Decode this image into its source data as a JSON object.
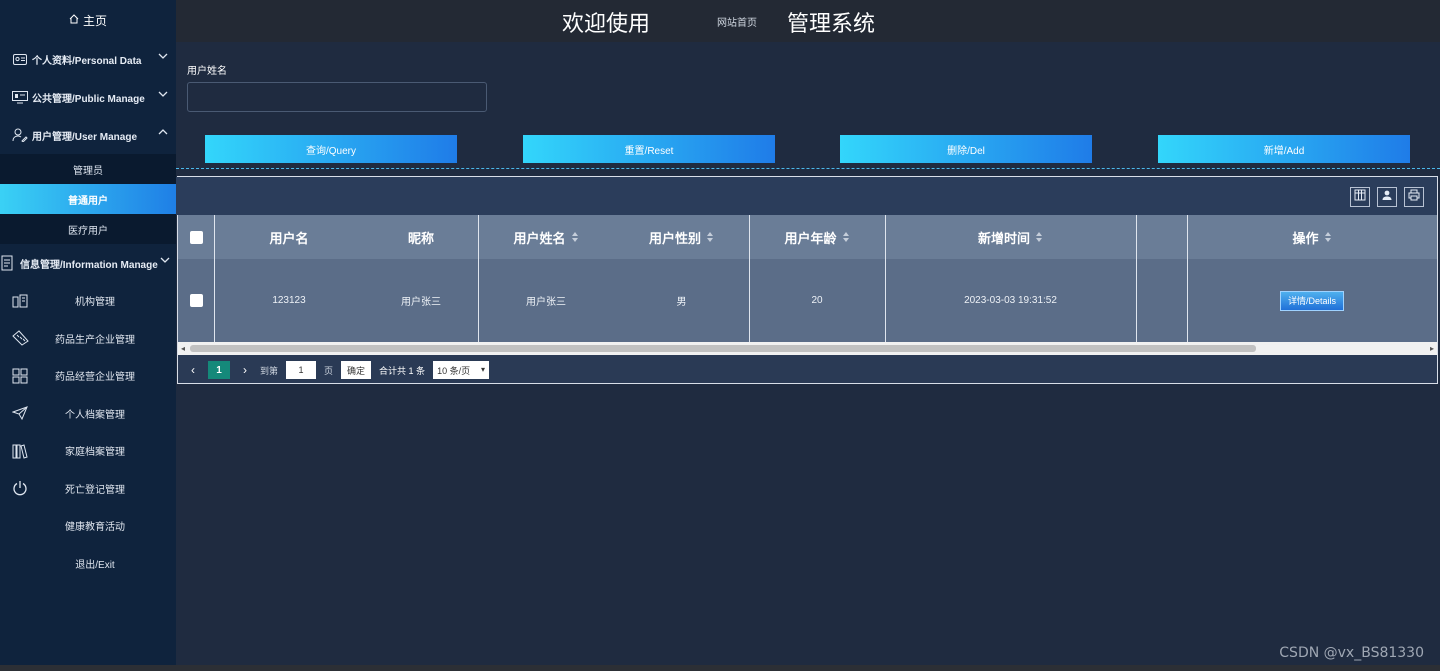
{
  "header": {
    "welcome": "欢迎使用",
    "site_home": "网站首页",
    "system": "管理系统"
  },
  "sidebar": {
    "home": "主页",
    "groups": [
      {
        "label": "个人资料/Personal Data",
        "icon": "id-card-icon"
      },
      {
        "label": "公共管理/Public Manage",
        "icon": "monitor-icon"
      },
      {
        "label": "用户管理/User Manage",
        "icon": "user-edit-icon"
      }
    ],
    "subitems": [
      "管理员",
      "普通用户",
      "医疗用户"
    ],
    "info_group": {
      "label": "信息管理/Information Manage",
      "icon": "document-icon"
    },
    "items": [
      {
        "label": "机构管理",
        "icon": "building-icon"
      },
      {
        "label": "药品生产企业管理",
        "icon": "ruler-icon"
      },
      {
        "label": "药品经营企业管理",
        "icon": "grid-icon"
      },
      {
        "label": "个人档案管理",
        "icon": "paper-plane-icon"
      },
      {
        "label": "家庭档案管理",
        "icon": "books-icon"
      },
      {
        "label": "死亡登记管理",
        "icon": "power-icon"
      },
      {
        "label": "健康教育活动",
        "icon": ""
      },
      {
        "label": "退出/Exit",
        "icon": ""
      }
    ]
  },
  "search": {
    "label": "用户姓名",
    "value": "",
    "placeholder": ""
  },
  "buttons": {
    "query": "查询/Query",
    "reset": "重置/Reset",
    "delete": "删除/Del",
    "add": "新增/Add"
  },
  "table": {
    "headers": [
      "用户名",
      "昵称",
      "用户姓名",
      "用户性别",
      "用户年龄",
      "新增时间",
      "",
      "操作"
    ],
    "rows": [
      {
        "username": "123123",
        "nickname": "用户张三",
        "realname": "用户张三",
        "gender": "男",
        "age": "20",
        "created": "2023-03-03 19:31:52",
        "action": "详情/Details"
      }
    ]
  },
  "pager": {
    "current_page": "1",
    "goto_label": "到第",
    "goto_value": "1",
    "page_unit": "页",
    "confirm": "确定",
    "total": "合计共 1 条",
    "page_size": "10 条/页"
  },
  "watermark": "CSDN @vx_BS81330",
  "colors": {
    "sidebar_bg": "#0f233d",
    "main_bg": "#1f2b40",
    "button_gradient_start": "#33d6fb",
    "button_gradient_end": "#1f7ce8",
    "active_page": "#15897a"
  }
}
